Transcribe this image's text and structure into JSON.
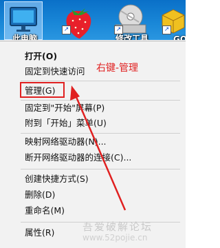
{
  "desktop": {
    "icons": [
      {
        "label": "此电脑"
      },
      {
        "label": ""
      },
      {
        "label": "修改工具"
      },
      {
        "label": "GO"
      }
    ]
  },
  "menu": {
    "items": [
      "打开(O)",
      "固定到快速访问",
      "管理(G)",
      "固定到\"开始\"屏幕(P)",
      "附到「开始」菜单(U)",
      "映射网络驱动器(N)...",
      "断开网络驱动器的连接(C)...",
      "创建快捷方式(S)",
      "删除(D)",
      "重命名(M)",
      "属性(R)"
    ]
  },
  "annotation": {
    "text": "右键-管理",
    "color": "#e02020"
  },
  "watermark": {
    "line1": "吾爱破解论坛",
    "line2": "www.52pojie.cn"
  },
  "colors": {
    "menu_bg": "#f2f2f2",
    "highlight": "#e02020",
    "desktop": "#1a88d8"
  }
}
